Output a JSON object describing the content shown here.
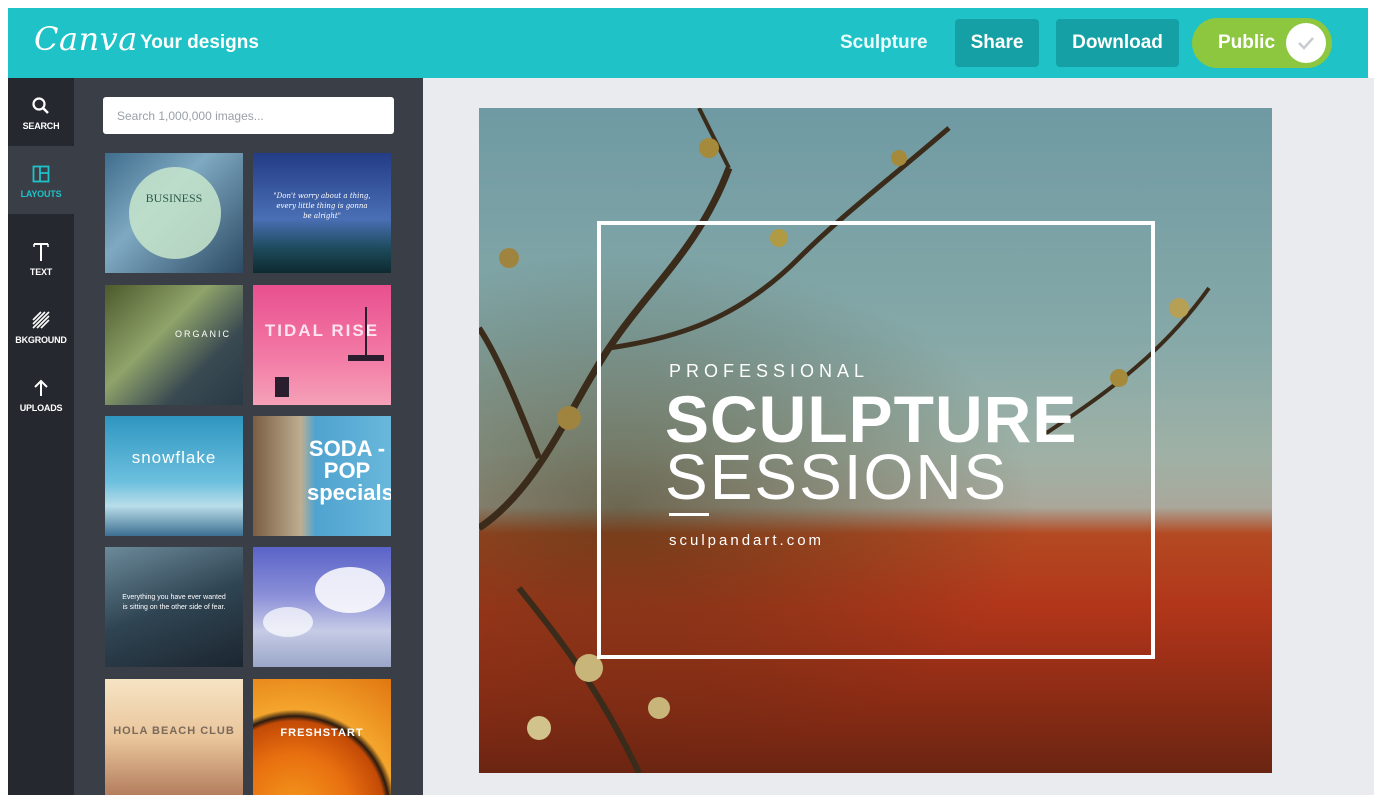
{
  "header": {
    "logo": "Canva",
    "nav_link": "Your designs",
    "document_title": "Sculpture",
    "share_label": "Share",
    "download_label": "Download",
    "public_label": "Public",
    "public_on": true
  },
  "sidebar": {
    "items": [
      {
        "label": "SEARCH",
        "icon": "search-icon"
      },
      {
        "label": "LAYOUTS",
        "icon": "layouts-icon",
        "active": true
      },
      {
        "label": "TEXT",
        "icon": "text-icon"
      },
      {
        "label": "BKGROUND",
        "icon": "background-icon"
      },
      {
        "label": "UPLOADS",
        "icon": "upload-icon"
      }
    ]
  },
  "panel": {
    "search_placeholder": "Search 1,000,000 images...",
    "layouts": [
      {
        "text": "BUSINESS"
      },
      {
        "text": "\"Don't worry about a thing, every little thing is gonna be alright\""
      },
      {
        "text": "ORGANIC"
      },
      {
        "text": "TIDAL RISE"
      },
      {
        "text": "snowflake"
      },
      {
        "text": "SODA -POP specials"
      },
      {
        "text": "Everything you have ever wanted is sitting on the other side of fear."
      },
      {
        "text": ""
      },
      {
        "text": "HOLA BEACH CLUB"
      },
      {
        "text": "FRESHSTART"
      }
    ]
  },
  "design": {
    "kicker": "PROFESSIONAL",
    "title": "SCULPTURE",
    "subtitle": "SESSIONS",
    "url": "sculpandart.com"
  },
  "colors": {
    "brand": "#1ec2c7",
    "button": "#14a0a4",
    "toggle": "#8dc63f",
    "nav_bg": "#25282e",
    "panel_bg": "#3a3f47"
  }
}
